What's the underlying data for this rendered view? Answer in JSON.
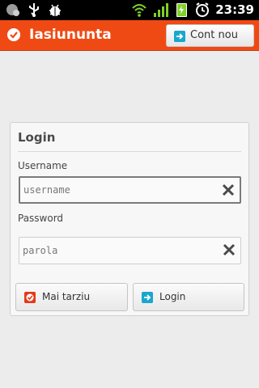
{
  "statusbar": {
    "time": "23:39",
    "icons": [
      "notification-icon",
      "usb-icon",
      "debug-icon",
      "wifi-icon",
      "signal-icon",
      "battery-charging-icon",
      "alarm-icon"
    ]
  },
  "appbar": {
    "title": "Iasiununta",
    "logo_icon": "check-badge-icon",
    "account_button_label": "Cont nou",
    "account_button_icon": "arrow-right-icon",
    "color": "#f04a14"
  },
  "login": {
    "title": "Login",
    "username_label": "Username",
    "username_placeholder": "username",
    "username_value": "",
    "password_label": "Password",
    "password_placeholder": "parola",
    "password_value": "",
    "clear_icon": "clear-x-icon",
    "later_button_label": "Mai tarziu",
    "later_button_icon": "check-badge-icon",
    "login_button_label": "Login",
    "login_button_icon": "arrow-right-icon"
  }
}
